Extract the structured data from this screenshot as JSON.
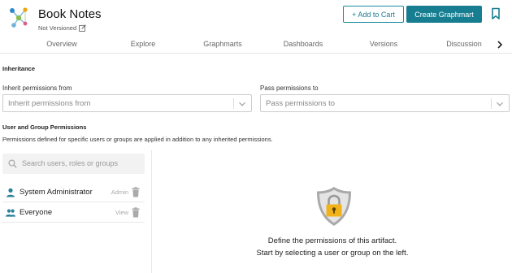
{
  "header": {
    "title": "Book Notes",
    "version_status": "Not Versioned",
    "add_to_cart_label": "+ Add to Cart",
    "create_label": "Create Graphmart"
  },
  "tabs": [
    "Overview",
    "Explore",
    "Graphmarts",
    "Dashboards",
    "Versions",
    "Discussion"
  ],
  "inheritance": {
    "section_title": "Inheritance",
    "inherit_label": "Inherit permissions from",
    "inherit_placeholder": "Inherit permissions from",
    "pass_label": "Pass permissions to",
    "pass_placeholder": "Pass permissions to"
  },
  "user_permissions": {
    "section_title": "User and Group Permissions",
    "description": "Permissions defined for specific users or groups are applied in addition to any inherited permissions.",
    "search_placeholder": "Search users, roles or groups",
    "entries": [
      {
        "name": "System Administrator",
        "role": "Admin",
        "icon": "person-icon"
      },
      {
        "name": "Everyone",
        "role": "View",
        "icon": "group-icon"
      }
    ]
  },
  "empty_state": {
    "line1": "Define the permissions of this artifact.",
    "line2": "Start by selecting a user or group on the left."
  },
  "colors": {
    "accent": "#177e92",
    "user_icon": "#2a7f9a",
    "lock": "#f2b21a",
    "shield": "#a9a9a9"
  }
}
